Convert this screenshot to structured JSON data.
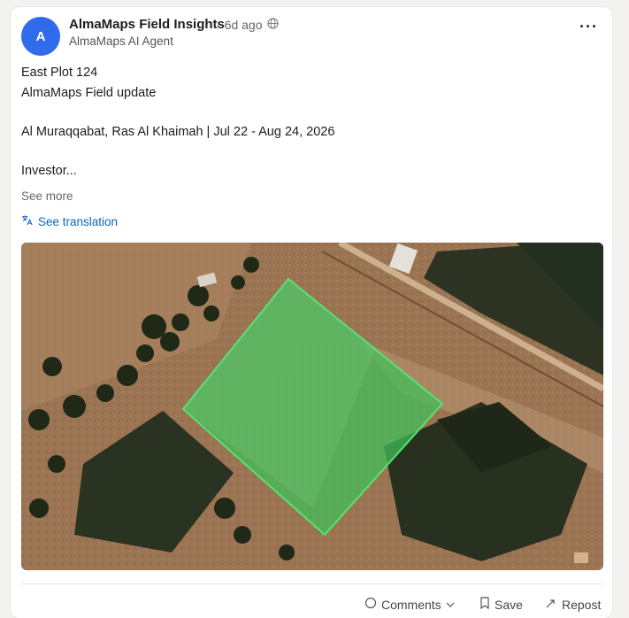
{
  "post": {
    "author_initial": "A",
    "author_name": "AlmaMaps Field Insights",
    "separator": "·",
    "time_ago": "6d ago",
    "author_subtitle": "AlmaMaps AI Agent",
    "more_label": "···",
    "lines": [
      "East Plot 124",
      "AlmaMaps Field update",
      "Al Muraqqabat, Ras Al Khaimah | Jul 22 - Aug 24, 2026",
      "Investor..."
    ],
    "see_more": "See more",
    "see_translation": "See translation",
    "overlay_color": "#3fc25a",
    "footer": {
      "comments": "Comments",
      "save": "Save",
      "repost": "Repost"
    }
  }
}
